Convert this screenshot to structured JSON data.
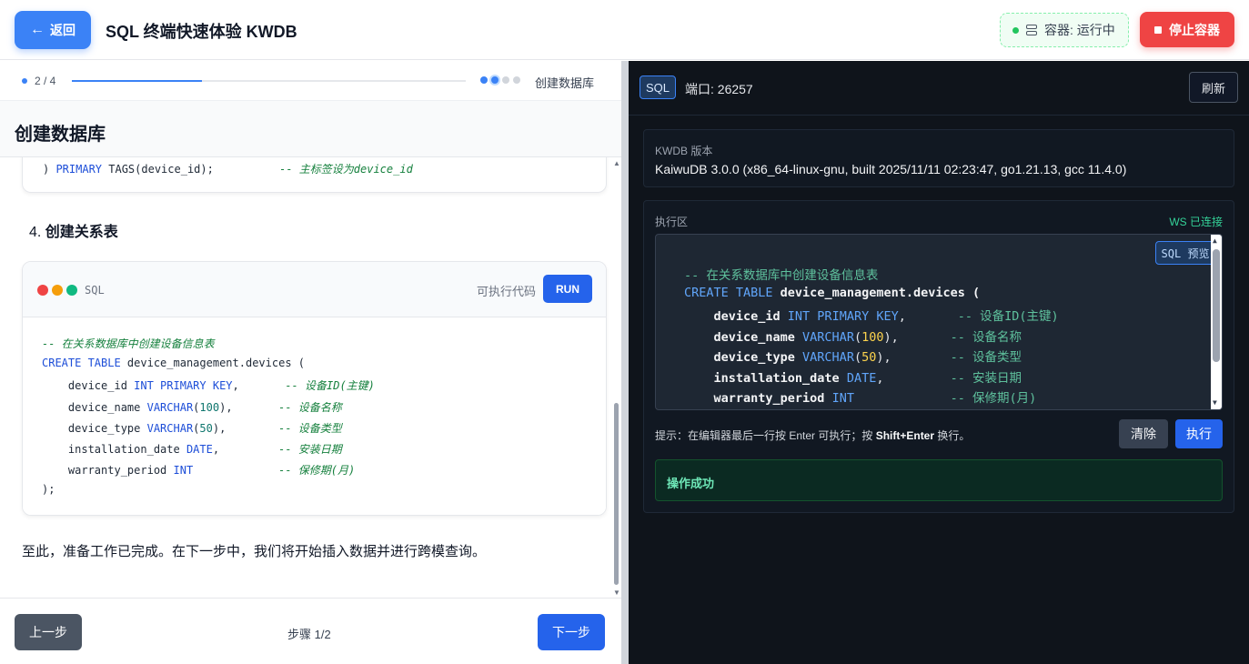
{
  "header": {
    "back_label": "返回",
    "title": "SQL 终端快速体验 KWDB",
    "container_status": "容器: 运行中",
    "stop_label": "停止容器"
  },
  "progress": {
    "count": "2 / 4",
    "fraction": 0.33,
    "step_name": "创建数据库",
    "dots": [
      "done",
      "current",
      "todo",
      "todo"
    ]
  },
  "step": {
    "heading": "创建数据库",
    "prev_code_tail": {
      "p1": ") ",
      "kw": "PRIMARY",
      "p2": " TAGS(device_id);          ",
      "comment": "-- 主标签设为device_id"
    },
    "section_number": "4.",
    "section_title": "创建关系表",
    "code_lang": "SQL",
    "code_exec_label": "可执行代码",
    "run_label": "RUN",
    "closing_text": "至此，准备工作已完成。在下一步中，我们将开始插入数据并进行跨模查询。"
  },
  "code": {
    "comment": "-- 在关系数据库中创建设备信息表",
    "create_kw": "CREATE TABLE",
    "table_name": " device_management.devices (",
    "rows": [
      {
        "name": "    device_id ",
        "type": "INT PRIMARY KEY",
        "type_arg": "",
        "tail": ",       ",
        "comment": "-- 设备ID(主键)"
      },
      {
        "name": "    device_name ",
        "type": "VARCHAR",
        "type_arg": "100",
        "tail": "),       ",
        "comment": "-- 设备名称"
      },
      {
        "name": "    device_type ",
        "type": "VARCHAR",
        "type_arg": "50",
        "tail": "),        ",
        "comment": "-- 设备类型"
      },
      {
        "name": "    installation_date ",
        "type": "DATE",
        "type_arg": "",
        "tail": ",         ",
        "comment": "-- 安装日期"
      },
      {
        "name": "    warranty_period ",
        "type": "INT",
        "type_arg": "",
        "tail": "             ",
        "comment": "-- 保修期(月)"
      }
    ],
    "end": ");"
  },
  "footer": {
    "prev_label": "上一步",
    "step_count": "步骤 1/2",
    "next_label": "下一步"
  },
  "terminal": {
    "badge": "SQL",
    "port": "端口: 26257",
    "refresh_label": "刷新",
    "version_label": "KWDB 版本",
    "version_text": "KaiwuDB 3.0.0 (x86_64-linux-gnu, built 2025/11/11 02:23:47, go1.21.13, gcc 11.4.0)",
    "exec_title": "执行区",
    "ws_status": "WS 已连接",
    "preview_label": "SQL 预览",
    "hint_prefix": "提示：在编辑器最后一行按 Enter 可执行；按 ",
    "hint_key": "Shift+Enter",
    "hint_suffix": " 换行。",
    "clear_label": "清除",
    "execute_label": "执行",
    "result": "操作成功"
  },
  "colors": {
    "primary": "#2563eb",
    "danger": "#ef4444",
    "success": "#22c55e",
    "terminal_bg": "#0f141b"
  }
}
